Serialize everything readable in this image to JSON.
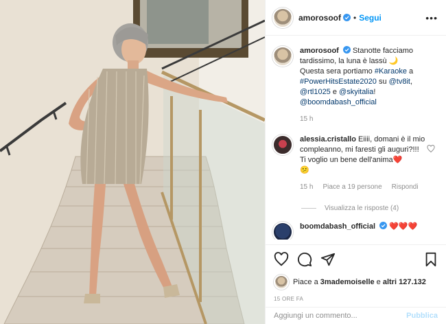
{
  "header": {
    "username": "amorosoof",
    "separator": "•",
    "follow_label": "Segui",
    "more_icon": "•••"
  },
  "caption": {
    "username": "amorosoof",
    "line1": "Stanotte facciamo tardissimo, la luna è lassù 🌙",
    "line2_prefix": "Questa sera portiamo ",
    "hashtag1": "#Karaoke",
    "line2_mid": " a ",
    "hashtag2": "#PowerHitsEstate2020",
    "line2_on": " su ",
    "mention1": "@tv8it",
    "comma": ",",
    "mention2": "@rtl1025",
    "and": " e ",
    "mention3": "@skyitalia",
    "excl": "!",
    "mention4": "@boomdabash_official",
    "age": "15 h"
  },
  "comment1": {
    "username": "alessia.cristallo",
    "text": "Eiiii, domani è il mio compleanno, mi faresti gli auguri?!!!",
    "text2": "Ti voglio un bene dell'anima❤️",
    "emoji": "😕",
    "age": "15 h",
    "likes": "Piace a 19 persone",
    "reply": "Rispondi"
  },
  "replies": {
    "label": "Visualizza le risposte (4)"
  },
  "comment2": {
    "username": "boomdabash_official",
    "text": "❤️❤️❤️"
  },
  "likes_line": {
    "prefix": "Piace a ",
    "user": "3mademoiselle",
    "mid": " e ",
    "others": "altri 127.132"
  },
  "timestamp": "15 ORE FA",
  "comment_box": {
    "placeholder": "Aggiungi un commento...",
    "publish_label": "Pubblica"
  },
  "colors": {
    "accent": "#0095f6",
    "link": "#00376b",
    "muted": "#8e8e8e",
    "like_red": "#ed4956"
  }
}
